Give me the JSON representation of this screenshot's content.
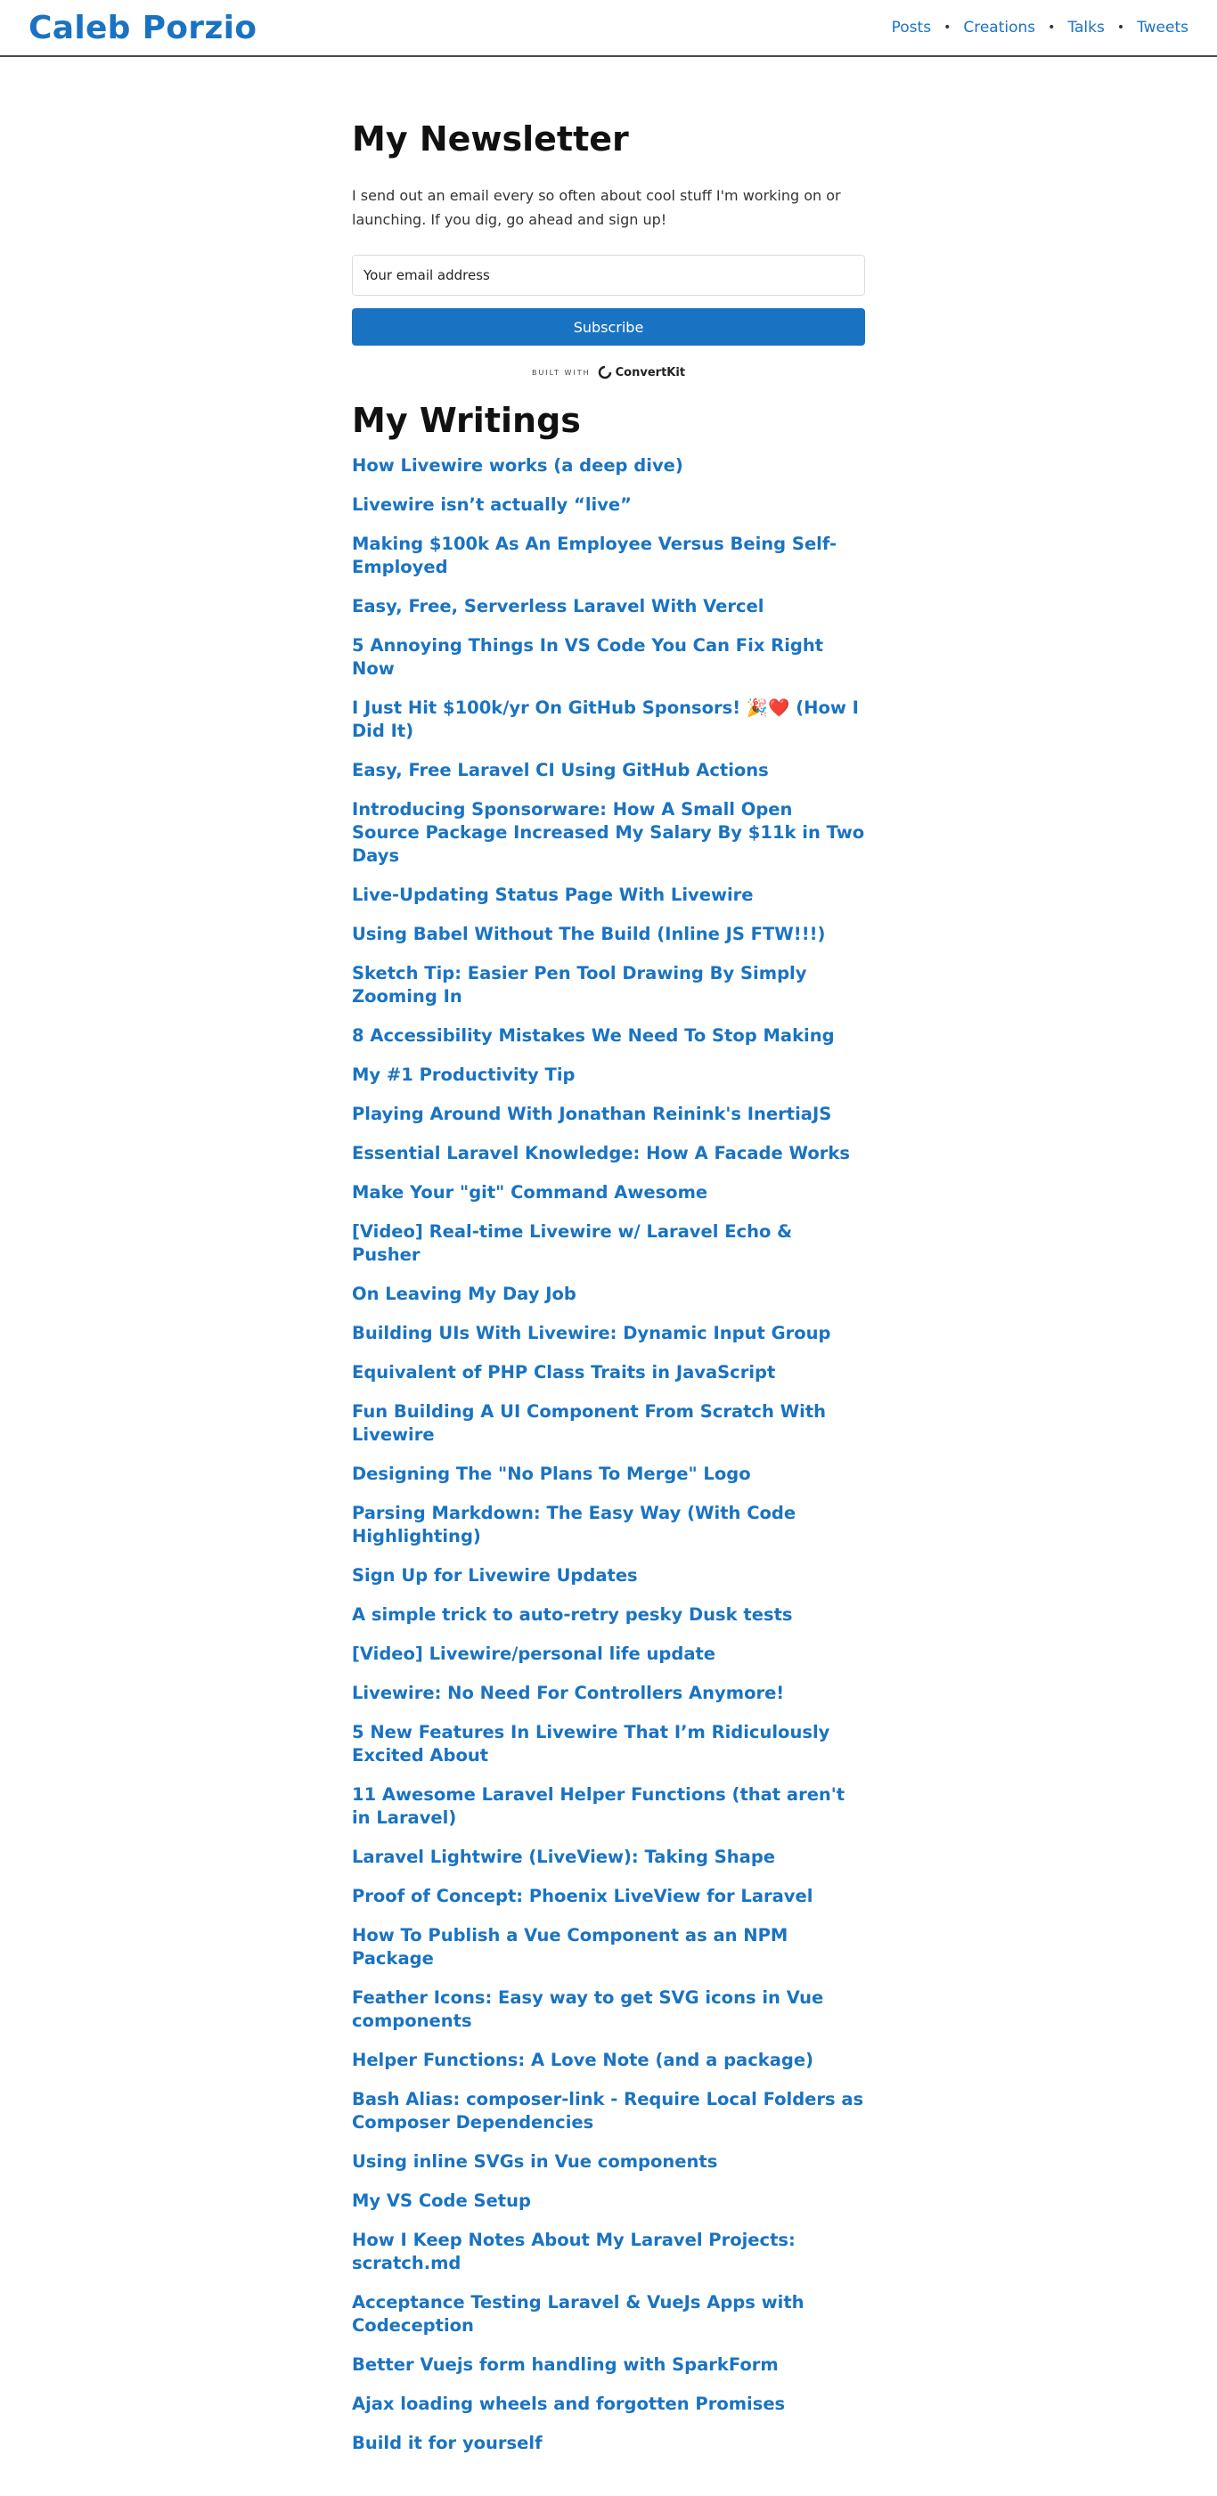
{
  "header": {
    "brand": "Caleb Porzio",
    "nav": [
      {
        "label": "Posts"
      },
      {
        "label": "Creations"
      },
      {
        "label": "Talks"
      },
      {
        "label": "Tweets"
      }
    ],
    "separator": "•"
  },
  "newsletter": {
    "title": "My Newsletter",
    "intro": "I send out an email every so often about cool stuff I'm working on or launching. If you dig, go ahead and sign up!",
    "email_placeholder": "Your email address",
    "subscribe_label": "Subscribe",
    "built_with": "BUILT WITH",
    "provider": "ConvertKit"
  },
  "writings": {
    "title": "My Writings",
    "posts": [
      "How Livewire works (a deep dive)",
      "Livewire isn’t actually “live”",
      "Making $100k As An Employee Versus Being Self-Employed",
      "Easy, Free, Serverless Laravel With Vercel",
      "5 Annoying Things In VS Code You Can Fix Right Now",
      "I Just Hit $100k/yr On GitHub Sponsors! 🎉❤️ (How I Did It)",
      "Easy, Free Laravel CI Using GitHub Actions",
      "Introducing Sponsorware: How A Small Open Source Package Increased My Salary By $11k in Two Days",
      "Live-Updating Status Page With Livewire",
      "Using Babel Without The Build (Inline JS FTW!!!)",
      "Sketch Tip: Easier Pen Tool Drawing By Simply Zooming In",
      "8 Accessibility Mistakes We Need To Stop Making",
      "My #1 Productivity Tip",
      "Playing Around With Jonathan Reinink's InertiaJS",
      "Essential Laravel Knowledge: How A Facade Works",
      "Make Your \"git\" Command Awesome",
      "[Video] Real-time Livewire w/ Laravel Echo & Pusher",
      "On Leaving My Day Job",
      "Building UIs With Livewire: Dynamic Input Group",
      "Equivalent of PHP Class Traits in JavaScript",
      "Fun Building A UI Component From Scratch With Livewire",
      "Designing The \"No Plans To Merge\" Logo",
      "Parsing Markdown: The Easy Way (With Code Highlighting)",
      "Sign Up for Livewire Updates",
      "A simple trick to auto-retry pesky Dusk tests",
      "[Video] Livewire/personal life update",
      "Livewire: No Need For Controllers Anymore!",
      "5 New Features In Livewire That I’m Ridiculously Excited About",
      "11 Awesome Laravel Helper Functions (that aren't in Laravel)",
      "Laravel Lightwire (LiveView): Taking Shape",
      "Proof of Concept: Phoenix LiveView for Laravel",
      "How To Publish a Vue Component as an NPM Package",
      "Feather Icons: Easy way to get SVG icons in Vue components",
      "Helper Functions: A Love Note (and a package)",
      "Bash Alias: composer-link - Require Local Folders as Composer Dependencies",
      "Using inline SVGs in Vue components",
      "My VS Code Setup",
      "How I Keep Notes About My Laravel Projects: scratch.md",
      "Acceptance Testing Laravel & VueJs Apps with Codeception",
      "Better Vuejs form handling with SparkForm",
      "Ajax loading wheels and forgotten Promises",
      "Build it for yourself"
    ]
  },
  "colors": {
    "link": "#1a73c2",
    "button": "#1a73c2",
    "header_border": "#4a4a4a"
  }
}
